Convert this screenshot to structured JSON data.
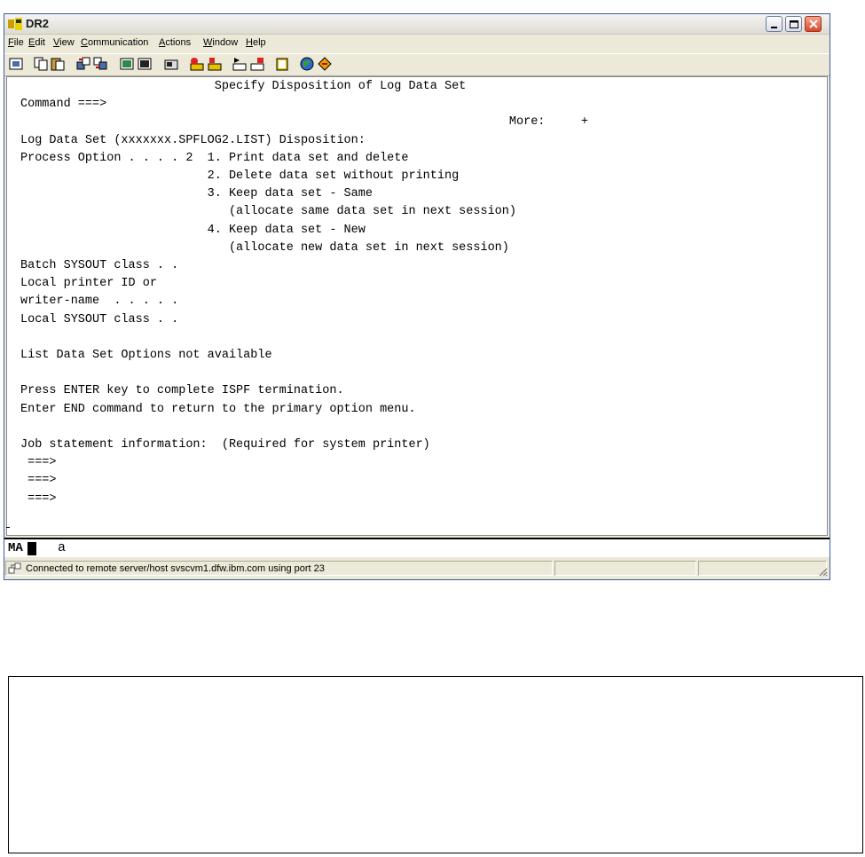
{
  "window": {
    "title": "DR2",
    "colors": {
      "titlebar": "#dedcd4",
      "close_button": "#d9482b",
      "terminal_bg": "#ffffff",
      "terminal_fg": "#000000"
    }
  },
  "menu": [
    {
      "label": "File",
      "ul": "F",
      "rest": "ile"
    },
    {
      "label": "Edit",
      "ul": "E",
      "rest": "dit"
    },
    {
      "label": "View",
      "ul": "V",
      "rest": "iew"
    },
    {
      "label": "Communication",
      "ul": "C",
      "rest": "ommunication"
    },
    {
      "label": "Actions",
      "ul": "A",
      "rest": "ctions"
    },
    {
      "label": "Window",
      "ul": "W",
      "rest": "indow"
    },
    {
      "label": "Help",
      "ul": "H",
      "rest": "elp"
    }
  ],
  "toolbar": {
    "icons": [
      "print-screen-icon",
      "copy-icon",
      "paste-icon",
      "send-file-icon",
      "receive-file-icon",
      "display-setup-icon",
      "keyboard-setup-icon",
      "macro-icon",
      "record-macro-icon",
      "stop-macro-icon",
      "play-macro-icon",
      "pause-macro-icon",
      "clipboard-icon",
      "web-icon",
      "help-diamond-icon"
    ]
  },
  "terminal": {
    "lines": [
      "                           Specify Disposition of Log Data Set",
      "Command ===>",
      "                                                                    More:     +",
      "Log Data Set (xxxxxxx.SPFLOG2.LIST) Disposition:",
      "Process Option . . . . 2  1. Print data set and delete",
      "                          2. Delete data set without printing",
      "                          3. Keep data set - Same",
      "                             (allocate same data set in next session)",
      "                          4. Keep data set - New",
      "                             (allocate new data set in next session)",
      "Batch SYSOUT class . .",
      "Local printer ID or",
      "writer-name  . . . . .",
      "Local SYSOUT class . .",
      "",
      "List Data Set Options not available",
      "",
      "Press ENTER key to complete ISPF termination.",
      "Enter END command to return to the primary option menu.",
      "",
      "Job statement information:  (Required for system printer)",
      " ===>",
      " ===>",
      " ===>"
    ]
  },
  "oia": {
    "mode": "MA",
    "char": "a"
  },
  "status": {
    "text": "Connected to remote server/host svscvm1.dfw.ibm.com using port 23"
  }
}
